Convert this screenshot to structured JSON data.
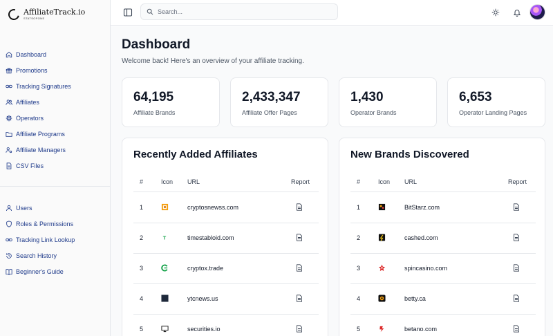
{
  "brand": {
    "title": "AffiliateTrack.io",
    "subtitle": "STATSOFONE"
  },
  "sidebar": {
    "primary": [
      {
        "label": "Dashboard",
        "icon": "home-icon"
      },
      {
        "label": "Promotions",
        "icon": "gift-icon"
      },
      {
        "label": "Tracking Signatures",
        "icon": "link-icon"
      },
      {
        "label": "Affiliates",
        "icon": "users-icon"
      },
      {
        "label": "Operators",
        "icon": "gear-icon"
      },
      {
        "label": "Affiliate Programs",
        "icon": "folder-icon"
      },
      {
        "label": "Affiliate Managers",
        "icon": "user-cog-icon"
      },
      {
        "label": "CSV Files",
        "icon": "file-icon"
      }
    ],
    "secondary": [
      {
        "label": "Users",
        "icon": "user-icon"
      },
      {
        "label": "Roles & Permissions",
        "icon": "shield-icon"
      },
      {
        "label": "Tracking Link Lookup",
        "icon": "link-icon"
      },
      {
        "label": "Search History",
        "icon": "history-icon"
      },
      {
        "label": "Beginner's Guide",
        "icon": "book-icon"
      }
    ]
  },
  "header": {
    "search_placeholder": "Search..."
  },
  "main": {
    "title": "Dashboard",
    "subtitle": "Welcome back! Here's an overview of your affiliate tracking.",
    "stats": [
      {
        "value": "64,195",
        "label": "Affiliate Brands"
      },
      {
        "value": "2,433,347",
        "label": "Affiliate Offer Pages"
      },
      {
        "value": "1,430",
        "label": "Operator Brands"
      },
      {
        "value": "6,653",
        "label": "Operator Landing Pages"
      }
    ],
    "affiliates": {
      "title": "Recently Added Affiliates",
      "columns": {
        "num": "#",
        "icon": "Icon",
        "url": "URL",
        "report": "Report"
      },
      "rows": [
        {
          "num": "1",
          "url": "cryptosnewss.com",
          "icon": "cryptosnewss-logo-icon"
        },
        {
          "num": "2",
          "url": "timestabloid.com",
          "icon": "timestabloid-logo-icon"
        },
        {
          "num": "3",
          "url": "cryptox.trade",
          "icon": "cryptox-logo-icon"
        },
        {
          "num": "4",
          "url": "ytcnews.us",
          "icon": "ytcnews-logo-icon"
        },
        {
          "num": "5",
          "url": "securities.io",
          "icon": "securities-logo-icon"
        }
      ]
    },
    "brands": {
      "title": "New Brands Discovered",
      "columns": {
        "num": "#",
        "icon": "Icon",
        "url": "URL",
        "report": "Report"
      },
      "rows": [
        {
          "num": "1",
          "url": "BitStarz.com",
          "icon": "bitstarz-logo-icon"
        },
        {
          "num": "2",
          "url": "cashed.com",
          "icon": "cashed-logo-icon"
        },
        {
          "num": "3",
          "url": "spincasino.com",
          "icon": "spincasino-logo-icon"
        },
        {
          "num": "4",
          "url": "betty.ca",
          "icon": "betty-logo-icon"
        },
        {
          "num": "5",
          "url": "betano.com",
          "icon": "betano-logo-icon"
        }
      ]
    }
  },
  "colors": {
    "nav_text": "#1e3a8a",
    "border": "#e5e7eb",
    "accent_bg": "#f9fafb"
  }
}
